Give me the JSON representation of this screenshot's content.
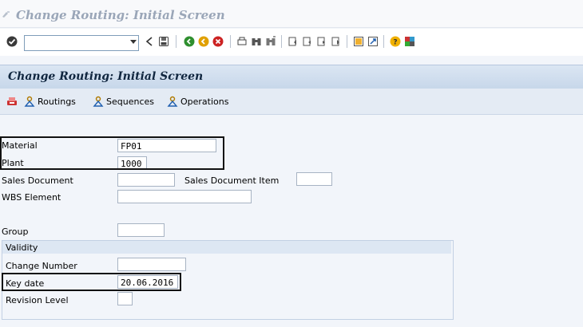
{
  "window": {
    "title": "Change Routing: Initial Screen"
  },
  "toolbar": {
    "command_field": {
      "value": "",
      "placeholder": ""
    },
    "icons": [
      "enter-icon",
      "back-icon",
      "save-icon",
      "back-nav-icon",
      "exit-icon",
      "cancel-icon",
      "print-icon",
      "find-icon",
      "find-next-icon",
      "first-page-icon",
      "previous-page-icon",
      "next-page-icon",
      "last-page-icon",
      "new-session-icon",
      "shortcut-icon",
      "help-icon",
      "customize-layout-icon"
    ]
  },
  "screen": {
    "title": "Change Routing: Initial Screen"
  },
  "app_toolbar": {
    "buttons": [
      {
        "label": "Routings"
      },
      {
        "label": "Sequences"
      },
      {
        "label": "Operations"
      }
    ]
  },
  "form": {
    "material": {
      "label": "Material",
      "value": "FP01"
    },
    "plant": {
      "label": "Plant",
      "value": "1000"
    },
    "sales_document": {
      "label": "Sales Document",
      "value": ""
    },
    "sales_document_item": {
      "label": "Sales Document Item",
      "value": ""
    },
    "wbs_element": {
      "label": "WBS Element",
      "value": ""
    },
    "group": {
      "label": "Group",
      "value": ""
    },
    "validity": {
      "title": "Validity",
      "change_number": {
        "label": "Change Number",
        "value": ""
      },
      "key_date": {
        "label": "Key date",
        "value": "20.06.2016"
      },
      "revision_level": {
        "label": "Revision Level",
        "value": ""
      }
    }
  },
  "colors": {
    "header_bg": "#c7d7ea",
    "title_text": "#10263f",
    "window_bg": "#f2f5fa"
  }
}
